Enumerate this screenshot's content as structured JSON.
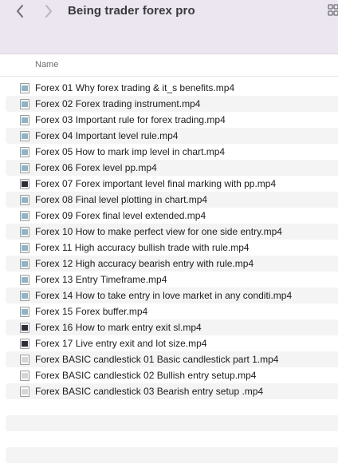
{
  "window": {
    "title": "Being trader forex pro"
  },
  "columns": {
    "name": "Name"
  },
  "files": [
    {
      "name": "Forex 01 Why forex trading & it_s benefits.mp4",
      "icon": "video-file-icon",
      "thumb": "blue"
    },
    {
      "name": "Forex 02 Forex trading instrument.mp4",
      "icon": "video-file-icon",
      "thumb": "blue"
    },
    {
      "name": "Forex 03 Important rule for forex trading.mp4",
      "icon": "video-file-icon",
      "thumb": "blue"
    },
    {
      "name": "Forex 04 Important level rule.mp4",
      "icon": "video-file-icon",
      "thumb": "blue"
    },
    {
      "name": "Forex 05 How to mark imp level in chart.mp4",
      "icon": "video-file-icon",
      "thumb": "blue"
    },
    {
      "name": "Forex 06 Forex level pp.mp4",
      "icon": "video-file-icon",
      "thumb": "blue"
    },
    {
      "name": "Forex 07 Forex important level final marking with pp.mp4",
      "icon": "video-file-icon",
      "thumb": "dark"
    },
    {
      "name": "Forex 08 Final level plotting in chart.mp4",
      "icon": "video-file-icon",
      "thumb": "blue"
    },
    {
      "name": "Forex 09 Forex final level extended.mp4",
      "icon": "video-file-icon",
      "thumb": "blue"
    },
    {
      "name": "Forex 10 How to make perfect view for one side entry.mp4",
      "icon": "video-file-icon",
      "thumb": "blue"
    },
    {
      "name": "Forex 11 High accuracy bullish trade with rule.mp4",
      "icon": "video-file-icon",
      "thumb": "blue"
    },
    {
      "name": "Forex 12 High accuracy bearish entry with rule.mp4",
      "icon": "video-file-icon",
      "thumb": "blue"
    },
    {
      "name": "Forex 13 Entry Timeframe.mp4",
      "icon": "video-file-icon",
      "thumb": "blue"
    },
    {
      "name": "Forex 14 How to take entry in love market in any conditi.mp4",
      "icon": "video-file-icon",
      "thumb": "blue"
    },
    {
      "name": "Forex 15 Forex buffer.mp4",
      "icon": "video-file-icon",
      "thumb": "blue"
    },
    {
      "name": "Forex 16 How to mark entry exit sl.mp4",
      "icon": "video-file-icon",
      "thumb": "dark"
    },
    {
      "name": "Forex 17 Live entry exit and lot size.mp4",
      "icon": "video-file-icon",
      "thumb": "dark"
    },
    {
      "name": "Forex BASIC candlestick 01 Basic candlestick part 1.mp4",
      "icon": "video-file-icon",
      "thumb": "light"
    },
    {
      "name": "Forex BASIC candlestick 02 Bullish entry setup.mp4",
      "icon": "video-file-icon",
      "thumb": "light"
    },
    {
      "name": "Forex BASIC candlestick 03 Bearish entry setup .mp4",
      "icon": "video-file-icon",
      "thumb": "light"
    }
  ]
}
